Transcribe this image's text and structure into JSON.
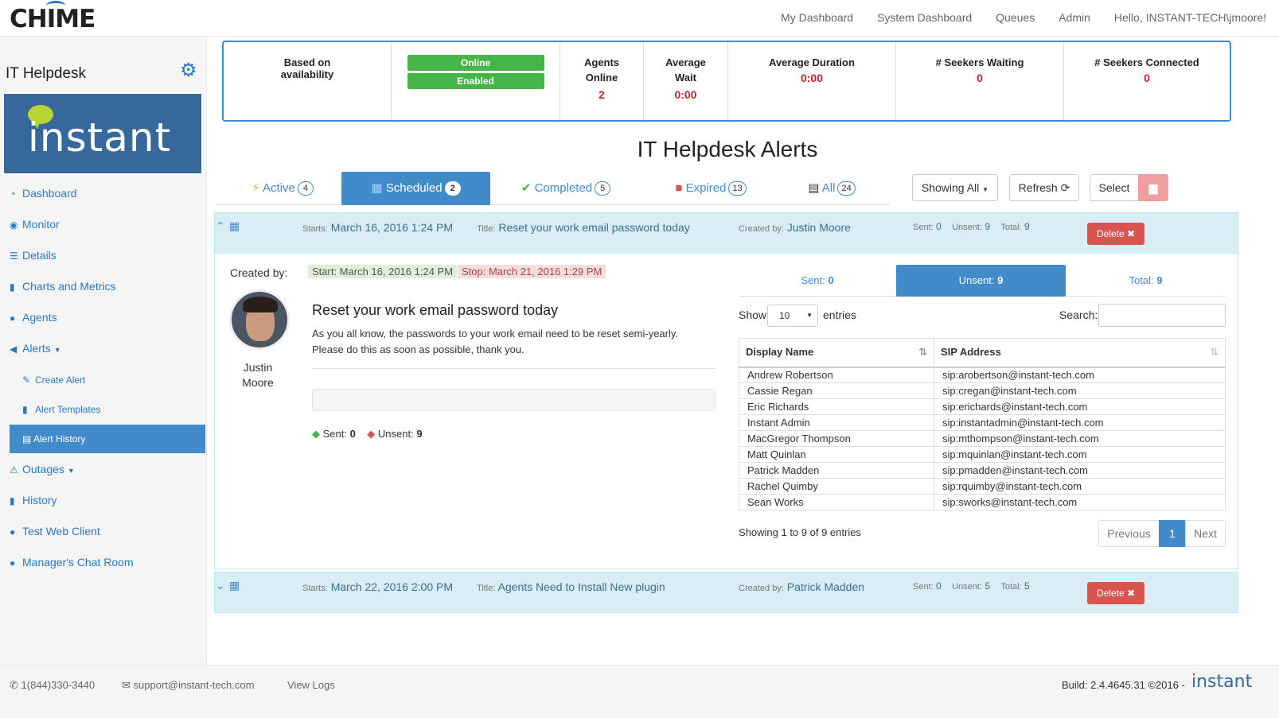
{
  "app": {
    "name": "CHIME"
  },
  "topnav": [
    "My Dashboard",
    "System Dashboard",
    "Queues",
    "Admin",
    "Hello, INSTANT-TECH\\jmoore!"
  ],
  "sidebar": {
    "title": "IT Helpdesk",
    "brand": "instant",
    "items": [
      "Dashboard",
      "Monitor",
      "Details",
      "Charts and Metrics",
      "Agents",
      "Alerts",
      "Create Alert",
      "Alert Templates",
      "Alert History",
      "Outages",
      "History",
      "Test Web Client",
      "Manager's Chat Room"
    ]
  },
  "stats": {
    "availability": "Based on availability",
    "online": "Online",
    "enabled": "Enabled",
    "agents_online_label": "Agents Online",
    "agents_online": "2",
    "avg_wait_label": "Average Wait",
    "avg_wait": "0:00",
    "avg_duration_label": "Average Duration",
    "avg_duration": "0:00",
    "seekers_waiting_label": "# Seekers Waiting",
    "seekers_waiting": "0",
    "seekers_connected_label": "# Seekers Connected",
    "seekers_connected": "0"
  },
  "page_title": "IT Helpdesk Alerts",
  "tabs": [
    {
      "label": "Active",
      "count": "4"
    },
    {
      "label": "Scheduled",
      "count": "2"
    },
    {
      "label": "Completed",
      "count": "5"
    },
    {
      "label": "Expired",
      "count": "13"
    },
    {
      "label": "All",
      "count": "24"
    }
  ],
  "toolbar": {
    "showing": "Showing All",
    "refresh": "Refresh",
    "select": "Select"
  },
  "alerts": [
    {
      "starts_label": "Starts:",
      "starts": "March 16, 2016 1:24 PM",
      "title_label": "Title:",
      "title": "Reset your work email password today",
      "created_label": "Created by:",
      "created_by": "Justin Moore",
      "sent": "0",
      "unsent": "9",
      "total": "9",
      "delete": "Delete"
    },
    {
      "starts_label": "Starts:",
      "starts": "March 22, 2016 2:00 PM",
      "title_label": "Title:",
      "title": "Agents Need to Install New plugin",
      "created_label": "Created by:",
      "created_by": "Patrick Madden",
      "sent": "0",
      "unsent": "5",
      "total": "5",
      "delete": "Delete"
    }
  ],
  "labels": {
    "sent": "Sent:",
    "unsent": "Unsent:",
    "total": "Total:"
  },
  "detail": {
    "created_by_label": "Created by:",
    "start": "Start: March 16, 2016 1:24 PM",
    "stop": "Stop: March 21, 2016 1:29 PM",
    "first": "Justin",
    "last": "Moore",
    "heading": "Reset your work email password today",
    "body": "As you all know, the passwords to your work email need to be reset semi-yearly. Please do this as soon as possible, thank you.",
    "sent": "0",
    "unsent": "9",
    "sent_label": "Sent:",
    "unsent_label": "Unsent:"
  },
  "recipients": {
    "tabs": [
      {
        "label": "Sent:",
        "count": "0"
      },
      {
        "label": "Unsent:",
        "count": "9"
      },
      {
        "label": "Total:",
        "count": "9"
      }
    ],
    "show": "Show",
    "entries_value": "10",
    "entries": "entries",
    "search": "Search:",
    "columns": [
      "Display Name",
      "SIP Address"
    ],
    "rows": [
      [
        "Andrew Robertson",
        "sip:arobertson@instant-tech.com"
      ],
      [
        "Cassie Regan",
        "sip:cregan@instant-tech.com"
      ],
      [
        "Eric Richards",
        "sip:erichards@instant-tech.com"
      ],
      [
        "Instant Admin",
        "sip:instantadmin@instant-tech.com"
      ],
      [
        "MacGregor Thompson",
        "sip:mthompson@instant-tech.com"
      ],
      [
        "Matt Quinlan",
        "sip:mquinlan@instant-tech.com"
      ],
      [
        "Patrick Madden",
        "sip:pmadden@instant-tech.com"
      ],
      [
        "Rachel Quimby",
        "sip:rquimby@instant-tech.com"
      ],
      [
        "Sean Works",
        "sip:sworks@instant-tech.com"
      ]
    ],
    "info": "Showing 1 to 9 of 9 entries",
    "previous": "Previous",
    "page": "1",
    "next": "Next"
  },
  "footer": {
    "phone": "1(844)330-3440",
    "email": "support@instant-tech.com",
    "logs": "View Logs",
    "build": "Build: 2.4.4645.31 ©2016 -",
    "brand": "instant"
  }
}
